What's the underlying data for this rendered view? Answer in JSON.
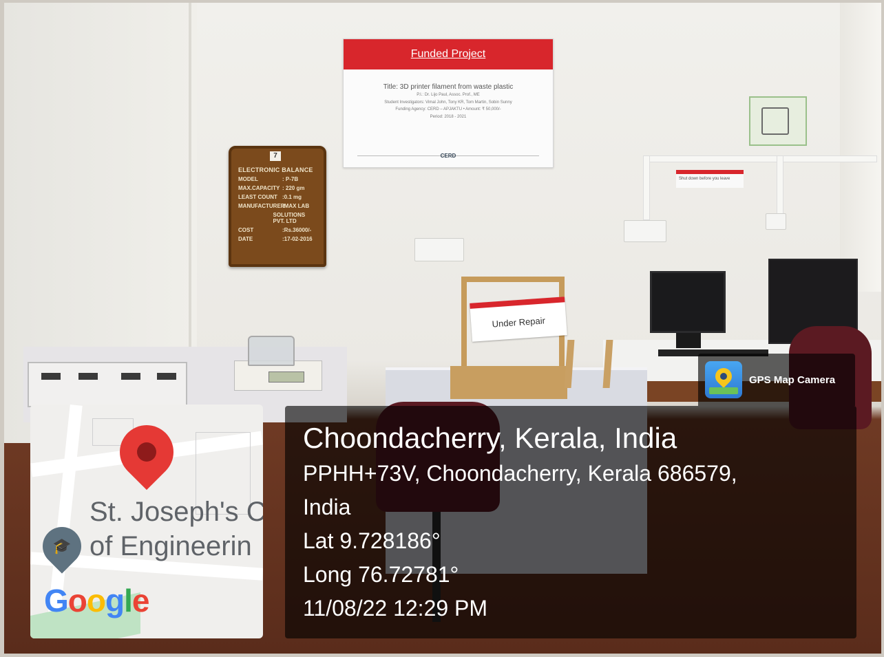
{
  "poster": {
    "heading": "Funded Project",
    "title": "Title: 3D printer filament from waste plastic",
    "pi": "P.I.: Dr. Lijo Paul, Assoc. Prof., ME",
    "students": "Student Investigators: Vimal John, Tony KR, Tom Martin, Sobin Sunny",
    "agency": "Funding Agency: CERD – APJAKTU  •  Amount: ₹ 50,000/-",
    "period": "Period: 2018 - 2021",
    "logo": "CERD"
  },
  "board": {
    "number": "7",
    "title": "ELECTRONIC BALANCE",
    "rows": [
      {
        "k": "MODEL",
        "v": ": P-7B"
      },
      {
        "k": "MAX.CAPACITY",
        "v": ": 220 gm"
      },
      {
        "k": "LEAST COUNT",
        "v": ":0.1 mg"
      },
      {
        "k": "MANUFACTURER",
        "v": ":MAX LAB"
      },
      {
        "k": "",
        "v": "SOLUTIONS PVT. LTD"
      },
      {
        "k": "COST",
        "v": ":Rs.36000/-"
      },
      {
        "k": "DATE",
        "v": ":17-02-2016"
      }
    ]
  },
  "signs": {
    "under_repair": "Under Repair",
    "shutdown": "Shut down before you leave"
  },
  "map": {
    "label_line1": "St. Joseph's C",
    "label_line2": "of Engineerin",
    "google": "Google"
  },
  "app": {
    "name": "GPS Map Camera"
  },
  "location": {
    "title": "Choondacherry, Kerala, India",
    "address_line1": "PPHH+73V, Choondacherry, Kerala 686579,",
    "address_line2": "India",
    "lat": "Lat 9.728186°",
    "long": "Long 76.72781°",
    "datetime": "11/08/22 12:29 PM"
  },
  "colors": {
    "accent_red": "#d8262c",
    "pin_red": "#e53935",
    "overlay": "rgba(0,0,0,0.62)"
  }
}
